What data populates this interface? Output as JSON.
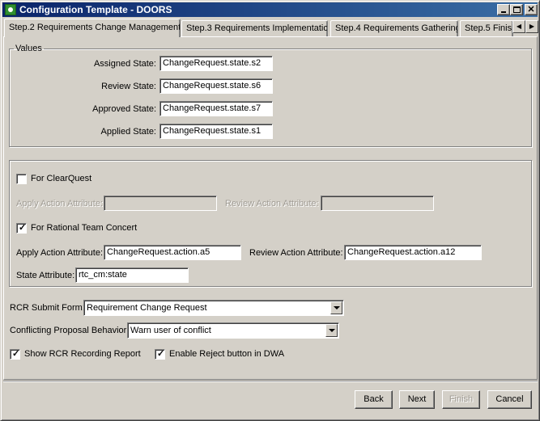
{
  "window": {
    "title": "Configuration Template - DOORS"
  },
  "tabs": [
    {
      "label": "Step.2 Requirements Change Management"
    },
    {
      "label": "Step.3 Requirements Implementation"
    },
    {
      "label": "Step.4 Requirements Gathering"
    },
    {
      "label": "Step.5 Finish"
    }
  ],
  "values_group": {
    "legend": "Values",
    "assigned_state": {
      "label": "Assigned State:",
      "value": "ChangeRequest.state.s2"
    },
    "review_state": {
      "label": "Review State:",
      "value": "ChangeRequest.state.s6"
    },
    "approved_state": {
      "label": "Approved State:",
      "value": "ChangeRequest.state.s7"
    },
    "applied_state": {
      "label": "Applied State:",
      "value": "ChangeRequest.state.s1"
    }
  },
  "clearquest": {
    "checkbox_label": "For ClearQuest",
    "checked": false,
    "apply_action_label": "Apply Action Attribute:",
    "apply_action_value": "",
    "review_action_label": "Review Action Attribute:",
    "review_action_value": ""
  },
  "rtc": {
    "checkbox_label": "For Rational Team Concert",
    "checked": true,
    "apply_action_label": "Apply Action Attribute:",
    "apply_action_value": "ChangeRequest.action.a5",
    "review_action_label": "Review Action Attribute:",
    "review_action_value": "ChangeRequest.action.a12",
    "state_label": "State Attribute:",
    "state_value": "rtc_cm:state"
  },
  "rcr_submit_form": {
    "label": "RCR Submit Form:",
    "selected": "Requirement Change Request"
  },
  "conflicting_behavior": {
    "label": "Conflicting Proposal Behavior:",
    "selected": "Warn user of conflict"
  },
  "options": {
    "show_report": {
      "label": "Show RCR Recording Report",
      "checked": true
    },
    "enable_reject": {
      "label": "Enable Reject button in DWA",
      "checked": true
    }
  },
  "buttons": {
    "back": "Back",
    "next": "Next",
    "finish": "Finish",
    "cancel": "Cancel"
  }
}
